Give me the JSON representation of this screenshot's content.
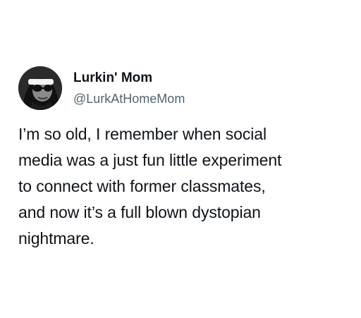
{
  "tweet": {
    "author": {
      "display_name": "Lurkin' Mom",
      "handle": "@LurkAtHomeMom",
      "avatar_icon": "profile-avatar-icon"
    },
    "text": "I’m so old, I remember when social\nmedia was a just fun little experiment\nto connect with former classmates,\nand now it’s a full blown dystopian\nnightmare."
  },
  "colors": {
    "background": "#ffffff",
    "text_primary": "#0f1419",
    "text_secondary": "#536471"
  }
}
